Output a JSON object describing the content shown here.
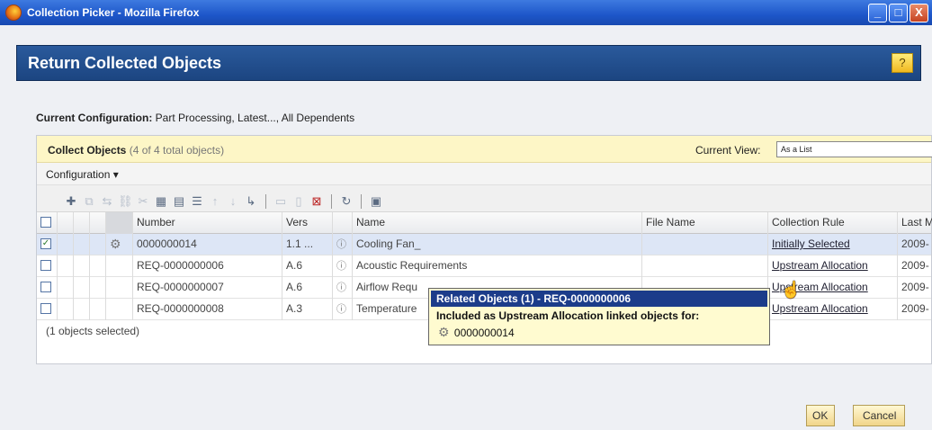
{
  "window": {
    "title": "Collection Picker - Mozilla Firefox",
    "minimize": "_",
    "maximize": "□",
    "close": "X"
  },
  "dialog": {
    "title": "Return Collected Objects",
    "help": "?"
  },
  "configuration": {
    "label": "Current Configuration:",
    "value": "Part Processing, Latest..., All Dependents"
  },
  "collect": {
    "label": "Collect Objects",
    "count": "(4 of 4 total objects)",
    "view_label": "Current View:",
    "view_value": "As a List"
  },
  "config_menu": "Configuration ▾",
  "toolbar_icons": [
    "add-icon",
    "copy-icon",
    "move-icon",
    "link-icon",
    "unlink-icon",
    "chart-icon",
    "doc-icon",
    "notes-icon",
    "up-icon",
    "down-icon",
    "arrow-icon",
    "paste-icon",
    "clear-icon",
    "remove-icon",
    "refresh-icon",
    "export-icon"
  ],
  "columns": {
    "number": "Number",
    "version": "Vers",
    "name": "Name",
    "file": "File Name",
    "rule": "Collection Rule",
    "last": "Last M"
  },
  "rows": [
    {
      "checked": true,
      "gear": true,
      "number": "0000000014",
      "version": "1.1",
      "dots": "...",
      "name": "Cooling Fan_",
      "file": "",
      "rule": "Initially Selected",
      "last": "2009-"
    },
    {
      "checked": false,
      "gear": false,
      "number": "REQ-0000000006",
      "version": "A.6",
      "dots": "",
      "name": "Acoustic Requirements",
      "file": "",
      "rule": "Upstream Allocation",
      "last": "2009-"
    },
    {
      "checked": false,
      "gear": false,
      "number": "REQ-0000000007",
      "version": "A.6",
      "dots": "",
      "name": "Airflow Requ",
      "file": "",
      "rule": "Upstream Allocation",
      "last": "2009-"
    },
    {
      "checked": false,
      "gear": false,
      "number": "REQ-0000000008",
      "version": "A.3",
      "dots": "",
      "name": "Temperature",
      "file": "",
      "rule": "Upstream Allocation",
      "last": "2009-"
    }
  ],
  "selected_count": "(1 objects selected)",
  "popup": {
    "title": "Related Objects (1) - REQ-0000000006",
    "description": "Included as Upstream Allocation linked objects for:",
    "item": "0000000014"
  },
  "buttons": {
    "ok": "OK",
    "cancel": "Cancel"
  }
}
